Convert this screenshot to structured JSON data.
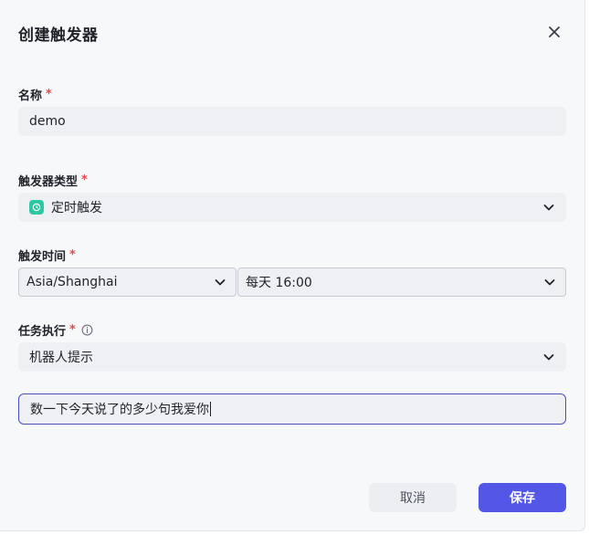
{
  "dialog": {
    "title": "创建触发器",
    "close_icon": "close-icon"
  },
  "fields": {
    "name": {
      "label": "名称",
      "required": "*",
      "value": "demo"
    },
    "trigger_type": {
      "label": "触发器类型",
      "required": "*",
      "value": "定时触发",
      "icon": "clock-icon",
      "icon_color": "#2ec7a4"
    },
    "trigger_time": {
      "label": "触发时间",
      "required": "*",
      "timezone": "Asia/Shanghai",
      "schedule": "每天 16:00"
    },
    "task": {
      "label": "任务执行",
      "required": "*",
      "value": "机器人提示",
      "info_icon": "info-icon"
    },
    "prompt": {
      "value": "数一下今天说了的多少句我爱你"
    }
  },
  "footer": {
    "cancel_label": "取消",
    "save_label": "保存"
  },
  "colors": {
    "primary": "#5257e8",
    "required": "#e5484d",
    "focus_border": "#4b4fb8"
  }
}
